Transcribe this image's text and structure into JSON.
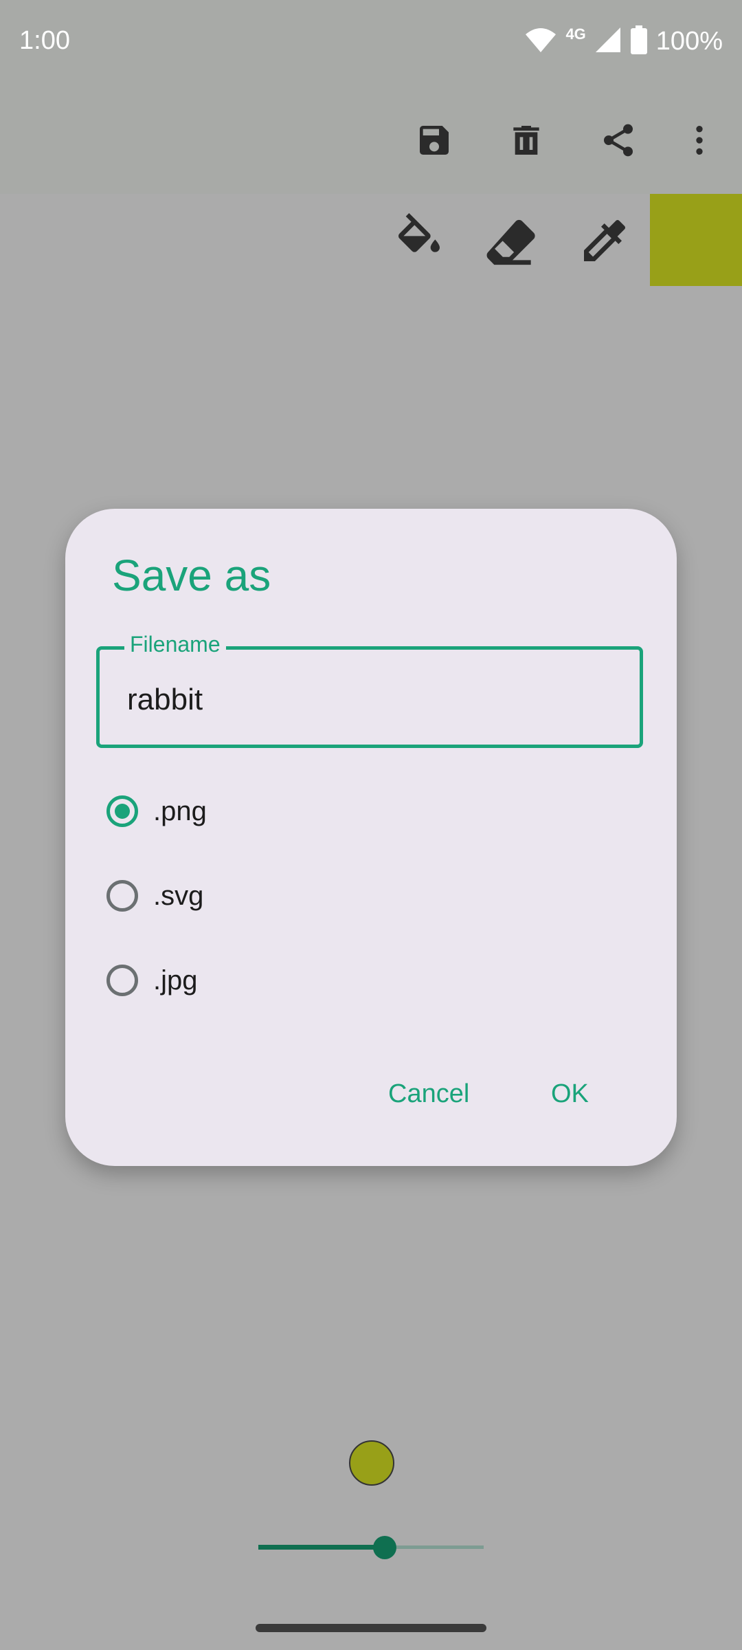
{
  "status_bar": {
    "time": "1:00",
    "network": "4G",
    "battery": "100%"
  },
  "toolbar": {
    "icons": [
      "save-icon",
      "delete-icon",
      "share-icon",
      "more-vert-icon"
    ]
  },
  "tools": {
    "icons": [
      "fill-bucket-icon",
      "eraser-icon",
      "eyedropper-icon"
    ],
    "current_color": "#98a018"
  },
  "dialog": {
    "title": "Save as",
    "filename_label": "Filename",
    "filename_value": "rabbit",
    "formats": [
      {
        "label": ".png",
        "selected": true
      },
      {
        "label": ".svg",
        "selected": false
      },
      {
        "label": ".jpg",
        "selected": false
      }
    ],
    "cancel_label": "Cancel",
    "ok_label": "OK"
  },
  "brush": {
    "color": "#98a018",
    "size_fraction": 0.56
  },
  "colors": {
    "accent": "#1aa37a",
    "slider": "#0f6f50",
    "dialog_background": "#ebe6ef"
  }
}
